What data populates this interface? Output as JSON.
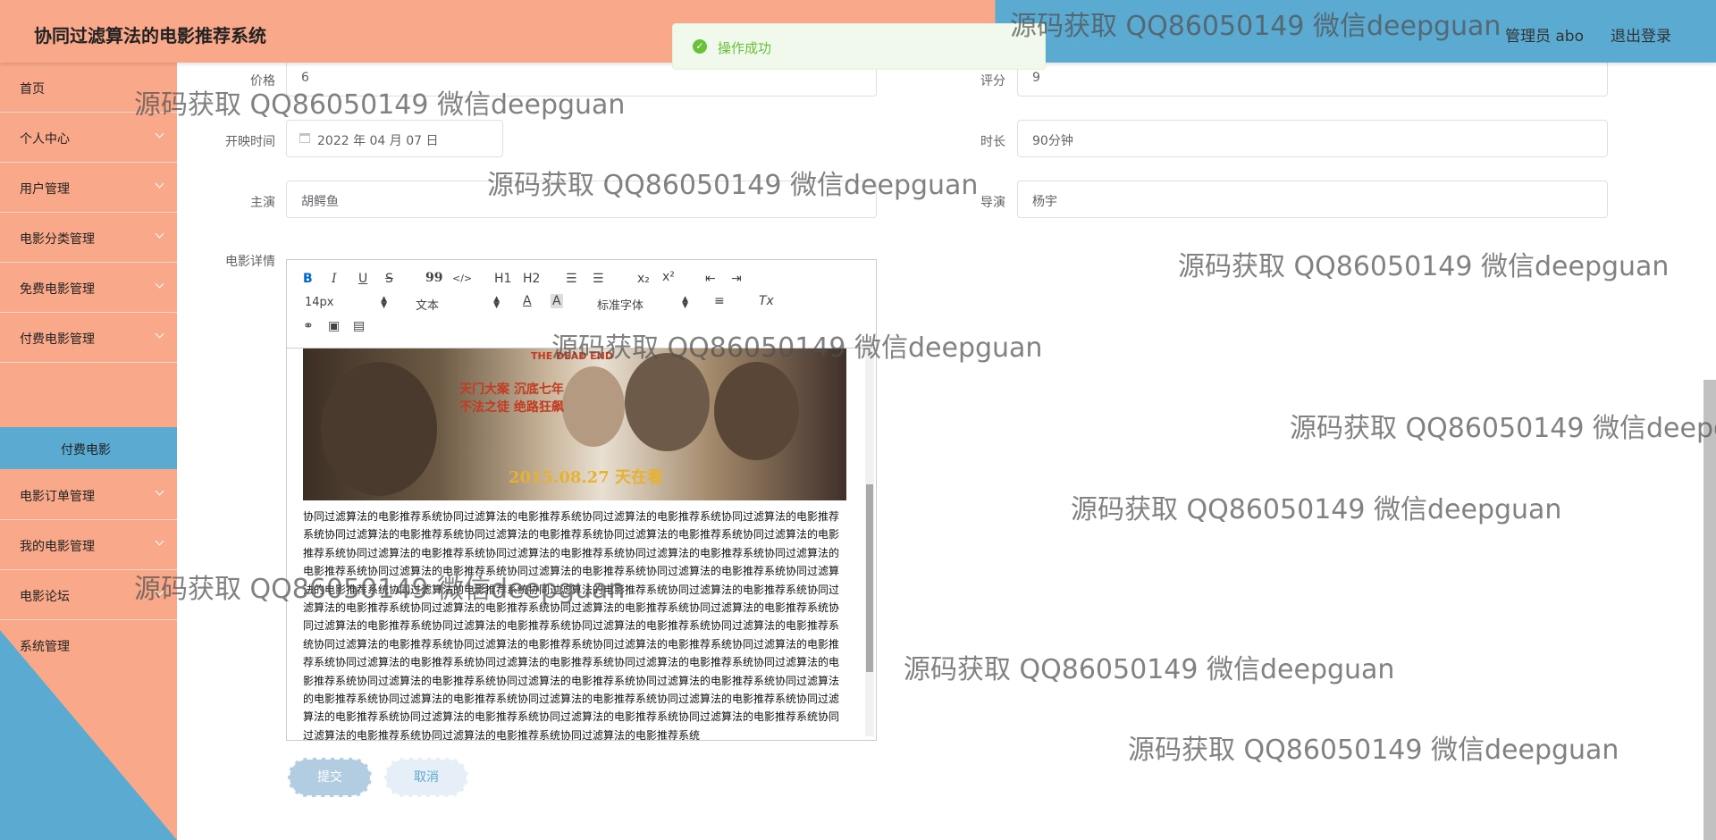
{
  "header": {
    "title": "协同过滤算法的电影推荐系统",
    "user": "管理员 abo",
    "logout": "退出登录"
  },
  "toast": {
    "text": "操作成功",
    "icon": "check-circle-icon"
  },
  "sidebar": {
    "items": [
      {
        "label": "首页"
      },
      {
        "label": "个人中心"
      },
      {
        "label": "用户管理"
      },
      {
        "label": "电影分类管理"
      },
      {
        "label": "免费电影管理"
      },
      {
        "label": "付费电影管理"
      },
      {
        "label": "电影订单管理"
      },
      {
        "label": "我的电影管理"
      },
      {
        "label": "电影论坛"
      },
      {
        "label": "系统管理"
      }
    ],
    "active_sub": "付费电影",
    "colors": {
      "primary": "#f9a98a",
      "accent": "#5aaad2"
    }
  },
  "form": {
    "price": {
      "label": "价格",
      "value": "6"
    },
    "rating": {
      "label": "评分",
      "value": "9"
    },
    "release": {
      "label": "开映时间",
      "value": "2022 年 04 月 07 日"
    },
    "duration": {
      "label": "时长",
      "value": "90分钟"
    },
    "actor": {
      "label": "主演",
      "value": "胡鳄鱼"
    },
    "director": {
      "label": "导演",
      "value": "杨宇"
    },
    "details_label": "电影详情"
  },
  "editor": {
    "toolbar": {
      "bold": "B",
      "italic": "I",
      "underline": "U",
      "strike": "S",
      "quote": "99",
      "code": "</>",
      "h1": "H1",
      "h2": "H2",
      "sub": "x₂",
      "sup": "x²",
      "size": "14px",
      "header": "文本",
      "font": "标准字体",
      "clean": "Tx"
    },
    "poster": {
      "english": "THE DEAD END",
      "line1": "天门大案 沉底七年",
      "line2": "不法之徒 绝路狂飙",
      "date": "2015.08.27 天在看"
    },
    "body_text": "协同过滤算法的电影推荐系统协同过滤算法的电影推荐系统协同过滤算法的电影推荐系统协同过滤算法的电影推荐系统协同过滤算法的电影推荐系统协同过滤算法的电影推荐系统协同过滤算法的电影推荐系统协同过滤算法的电影推荐系统协同过滤算法的电影推荐系统协同过滤算法的电影推荐系统协同过滤算法的电影推荐系统协同过滤算法的电影推荐系统协同过滤算法的电影推荐系统协同过滤算法的电影推荐系统协同过滤算法的电影推荐系统协同过滤算法的电影推荐系统协同过滤算法的电影推荐系统协同过滤算法的电影推荐系统协同过滤算法的电影推荐系统协同过滤算法的电影推荐系统协同过滤算法的电影推荐系统协同过滤算法的电影推荐系统协同过滤算法的电影推荐系统协同过滤算法的电影推荐系统协同过滤算法的电影推荐系统协同过滤算法的电影推荐系统协同过滤算法的电影推荐系统协同过滤算法的电影推荐系统协同过滤算法的电影推荐系统协同过滤算法的电影推荐系统协同过滤算法的电影推荐系统协同过滤算法的电影推荐系统协同过滤算法的电影推荐系统协同过滤算法的电影推荐系统协同过滤算法的电影推荐系统协同过滤算法的电影推荐系统协同过滤算法的电影推荐系统协同过滤算法的电影推荐系统协同过滤算法的电影推荐系统协同过滤算法的电影推荐系统协同过滤算法的电影推荐系统协同过滤算法的电影推荐系统协同过滤算法的电影推荐系统协同过滤算法的电影推荐系统协同过滤算法的电影推荐系统协同过滤算法的电影推荐系统协同过滤算法的电影推荐系统协同过滤算法的电影推荐系统协同过滤算法的电影推荐系统"
  },
  "buttons": {
    "submit": "提交",
    "cancel": "取消"
  },
  "watermark": "源码获取 QQ86050149 微信deepguan"
}
